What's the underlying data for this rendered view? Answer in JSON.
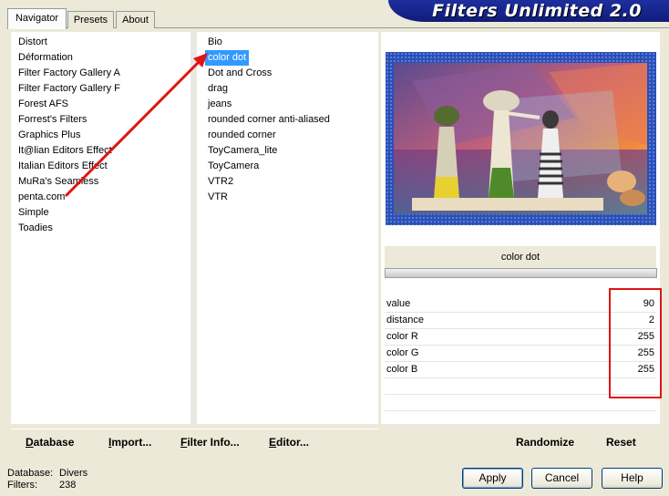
{
  "banner": {
    "title": "Filters Unlimited 2.0"
  },
  "tabs": [
    {
      "label": "Navigator",
      "active": true
    },
    {
      "label": "Presets",
      "active": false
    },
    {
      "label": "About",
      "active": false
    }
  ],
  "categories": [
    "Distort",
    "Déformation",
    "Filter Factory Gallery A",
    "Filter Factory Gallery F",
    "Forest AFS",
    "Forrest's Filters",
    "Graphics Plus",
    "It@lian Editors Effect",
    "Italian Editors Effect",
    "MuRa's Seamless",
    "penta.com",
    "Simple",
    "Toadies"
  ],
  "filters": [
    "Bio",
    "color dot",
    "Dot and Cross",
    "drag",
    "jeans",
    "rounded corner anti-aliased",
    "rounded corner",
    "ToyCamera_lite",
    "ToyCamera",
    "VTR2",
    "VTR"
  ],
  "selected_filter": "color dot",
  "params": [
    {
      "name": "value",
      "value": "90"
    },
    {
      "name": "distance",
      "value": "2"
    },
    {
      "name": "color R",
      "value": "255"
    },
    {
      "name": "color G",
      "value": "255"
    },
    {
      "name": "color B",
      "value": "255"
    }
  ],
  "toolbar": {
    "database": {
      "u": "D",
      "rest": "atabase"
    },
    "import": {
      "u": "I",
      "rest": "mport..."
    },
    "filter_info": {
      "u": "F",
      "rest": "ilter Info..."
    },
    "editor": {
      "u": "E",
      "rest": "ditor..."
    },
    "randomize": "Randomize",
    "reset": "Reset"
  },
  "footer": {
    "database_label": "Database:",
    "database_value": "Divers",
    "filters_label": "Filters:",
    "filters_value": "238"
  },
  "buttons": {
    "apply": "Apply",
    "cancel": "Cancel",
    "help": "Help"
  },
  "colors": {
    "selection": "#3399ff",
    "banner": "#1a2a96",
    "annotation": "#e01414",
    "preview_border": "#2b4fb3"
  }
}
